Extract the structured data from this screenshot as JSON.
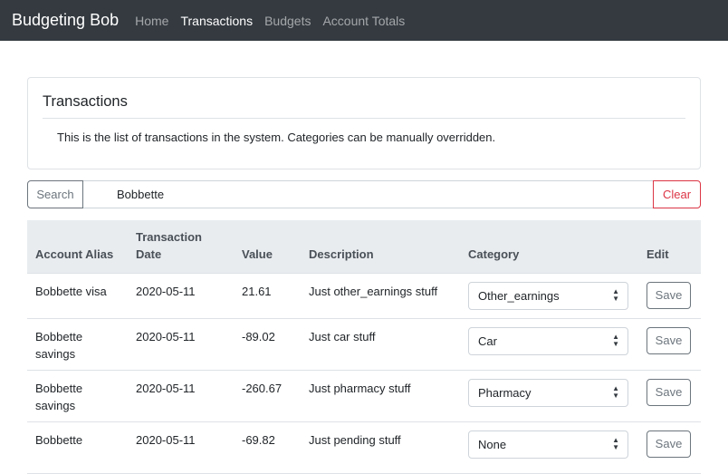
{
  "navbar": {
    "brand": "Budgeting Bob",
    "links": [
      {
        "label": "Home",
        "active": false
      },
      {
        "label": "Transactions",
        "active": true
      },
      {
        "label": "Budgets",
        "active": false
      },
      {
        "label": "Account Totals",
        "active": false
      }
    ]
  },
  "card": {
    "title": "Transactions",
    "text": "This is the list of transactions in the system. Categories can be manually overridden."
  },
  "search": {
    "button_label": "Search",
    "value": "Bobbette",
    "clear_label": "Clear"
  },
  "table": {
    "headers": {
      "alias": "Account Alias",
      "date_line1": "Transaction",
      "date_line2": "Date",
      "value": "Value",
      "description": "Description",
      "category": "Category",
      "edit": "Edit"
    },
    "rows": [
      {
        "alias": "Bobbette visa",
        "date": "2020-05-11",
        "value": "21.61",
        "description": "Just other_earnings stuff",
        "category": "Other_earnings",
        "save_label": "Save"
      },
      {
        "alias": "Bobbette savings",
        "date": "2020-05-11",
        "value": "-89.02",
        "description": "Just car stuff",
        "category": "Car",
        "save_label": "Save"
      },
      {
        "alias": "Bobbette savings",
        "date": "2020-05-11",
        "value": "-260.67",
        "description": "Just pharmacy stuff",
        "category": "Pharmacy",
        "save_label": "Save"
      },
      {
        "alias": "Bobbette",
        "date": "2020-05-11",
        "value": "-69.82",
        "description": "Just pending stuff",
        "category": "None",
        "save_label": "Save"
      }
    ]
  },
  "colors": {
    "navbar_bg": "#343a40",
    "header_bg": "#e9ecef",
    "danger": "#dc3545",
    "secondary": "#6c757d"
  }
}
